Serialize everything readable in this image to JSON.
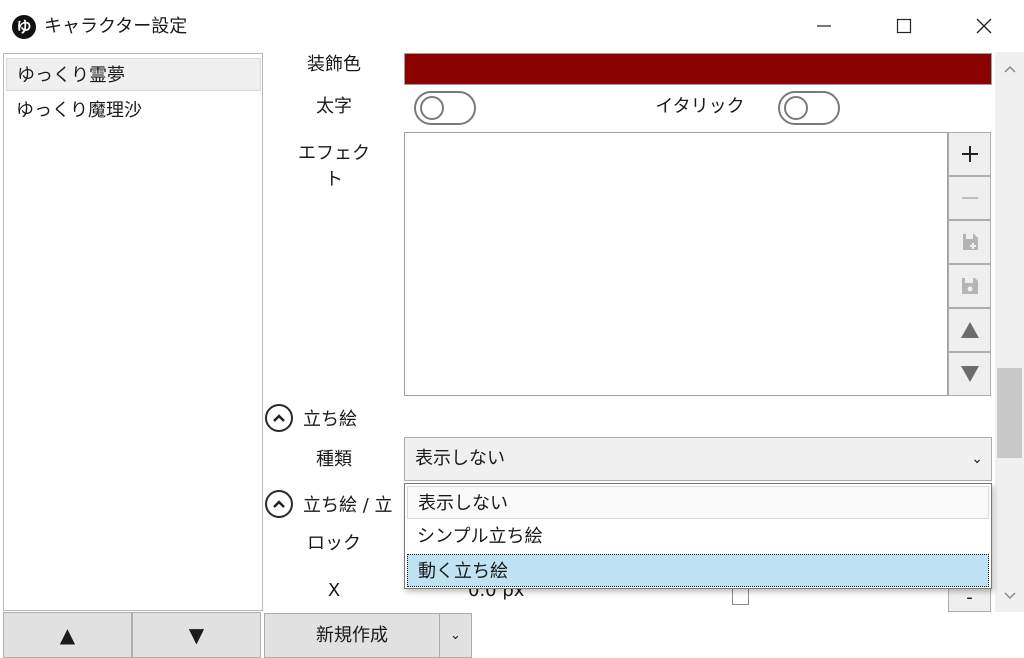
{
  "window": {
    "title": "キャラクター設定",
    "app_icon_glyph": "ゆ",
    "controls": {
      "minimize": "minimize-icon",
      "maximize": "maximize-icon",
      "close": "close-icon"
    }
  },
  "character_list": {
    "items": [
      {
        "label": "ゆっくり霊夢",
        "selected": true
      },
      {
        "label": "ゆっくり魔理沙",
        "selected": false
      }
    ],
    "move_up_label": "▲",
    "move_down_label": "▼"
  },
  "settings": {
    "decoration_color": {
      "label": "装飾色",
      "value": "#8b0000"
    },
    "bold": {
      "label": "太字",
      "on": false
    },
    "italic": {
      "label": "イタリック",
      "on": false
    },
    "effect": {
      "label": "エフェクト",
      "buttons": [
        "add-icon",
        "remove-icon",
        "paste-preset-icon",
        "save-preset-icon",
        "move-up-icon",
        "move-down-icon"
      ]
    },
    "tachie_section": {
      "title": "立ち絵",
      "kind_label": "種類",
      "kind_selected": "表示しない",
      "kind_options": [
        "表示しない",
        "シンプル立ち絵",
        "動く立ち絵"
      ],
      "highlighted_option_index": 2
    },
    "tachie2_section": {
      "title": "立ち絵 / 立",
      "lock_label": "ロック",
      "x_label": "X",
      "x_value": "0.0 px"
    }
  },
  "footer": {
    "new_button_label": "新規作成",
    "new_dropdown_glyph": "⌄"
  },
  "colors": {
    "decoration_red": "#8b0000",
    "highlight_blue": "#bfe3f2",
    "button_gray": "#e1e1e1"
  }
}
